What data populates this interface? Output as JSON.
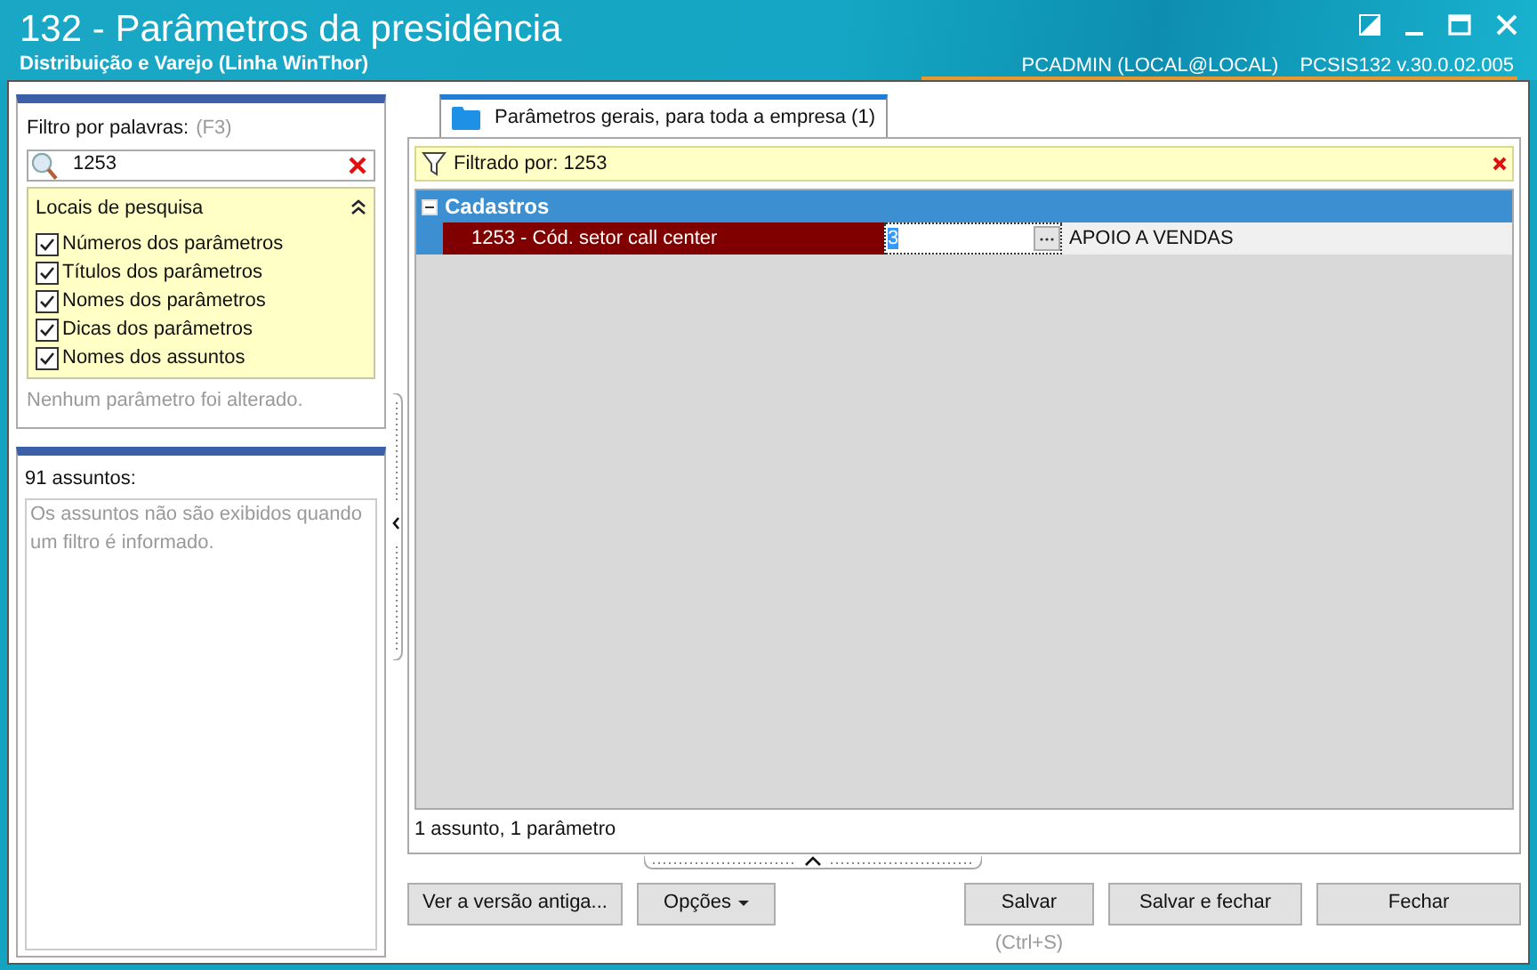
{
  "window": {
    "title": "132 - Parâmetros da presidência",
    "subtitle": "Distribuição e Varejo (Linha WinThor)",
    "user": "PCADMIN (LOCAL@LOCAL)",
    "version": "PCSIS132  v.30.0.02.005"
  },
  "filter": {
    "label": "Filtro por palavras:",
    "shortcut": "(F3)",
    "value": "1253"
  },
  "search_places": {
    "title": "Locais de pesquisa",
    "expanded": true,
    "items": [
      {
        "label": "Números dos parâmetros",
        "checked": true
      },
      {
        "label": "Títulos dos parâmetros",
        "checked": true
      },
      {
        "label": "Nomes dos parâmetros",
        "checked": true
      },
      {
        "label": "Dicas dos parâmetros",
        "checked": true
      },
      {
        "label": "Nomes dos assuntos",
        "checked": true
      }
    ]
  },
  "changes_note": "Nenhum parâmetro foi alterado.",
  "subjects": {
    "title": "91 assuntos:",
    "note": "Os assuntos não são exibidos quando um filtro é informado."
  },
  "tabs": [
    {
      "label": "Parâmetros gerais, para toda a empresa  (1)",
      "selected": true
    }
  ],
  "filter_bar": {
    "text": "Filtrado por: 1253"
  },
  "groups": [
    {
      "title": "Cadastros",
      "expanded": true,
      "rows": [
        {
          "name": "1253 - Cód. setor call center",
          "value": "3",
          "description": "APOIO A VENDAS"
        }
      ]
    }
  ],
  "status": "1 assunto, 1 parâmetro",
  "buttons": {
    "old_version": "Ver a versão antiga...",
    "options": "Opções",
    "save": "Salvar",
    "save_hint": "(Ctrl+S)",
    "save_close": "Salvar e fechar",
    "close": "Fechar"
  }
}
